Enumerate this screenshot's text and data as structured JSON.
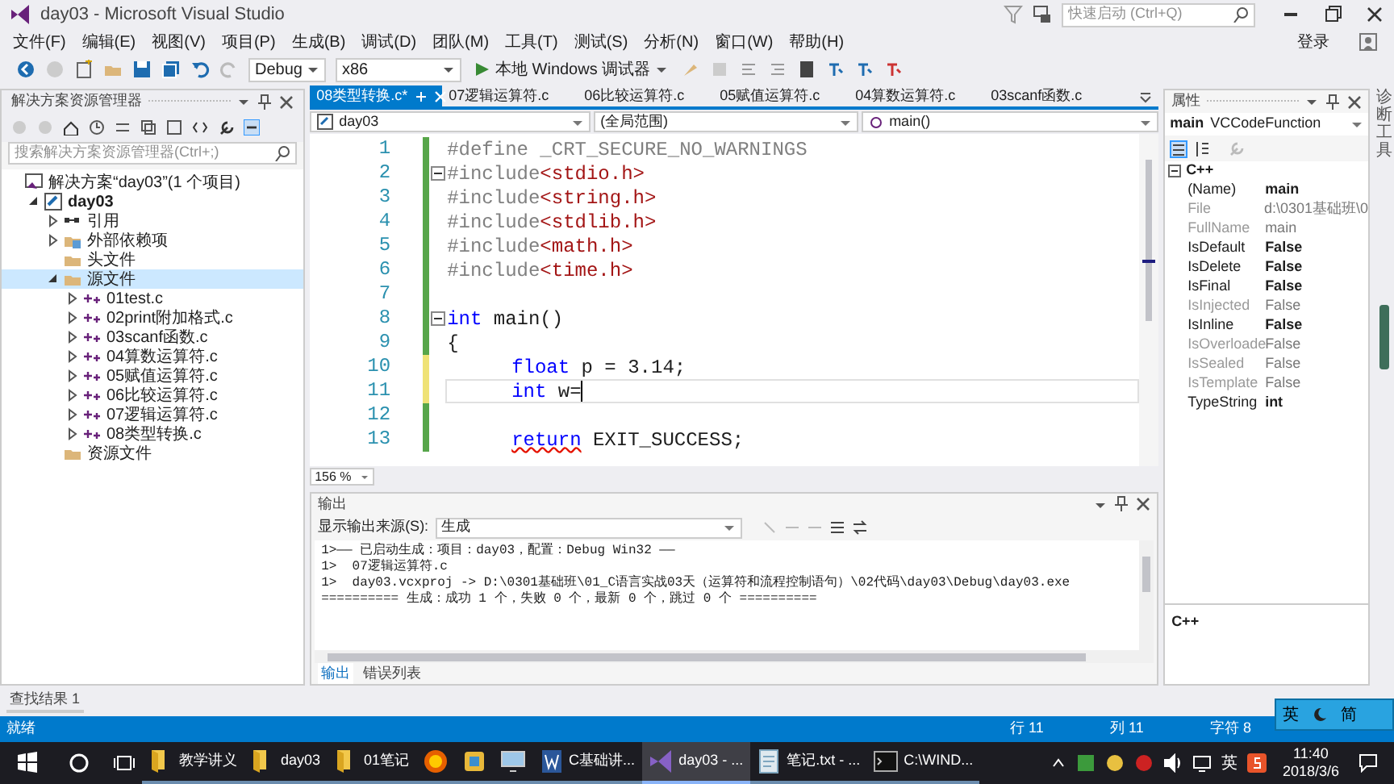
{
  "window": {
    "title": "day03 - Microsoft Visual Studio"
  },
  "quick_launch": {
    "placeholder": "快速启动 (Ctrl+Q)"
  },
  "sign_in": "登录",
  "menu": [
    "文件(F)",
    "编辑(E)",
    "视图(V)",
    "项目(P)",
    "生成(B)",
    "调试(D)",
    "团队(M)",
    "工具(T)",
    "测试(S)",
    "分析(N)",
    "窗口(W)",
    "帮助(H)"
  ],
  "toolbar": {
    "configuration": "Debug",
    "platform": "x86",
    "run": "本地 Windows 调试器"
  },
  "solution_explorer": {
    "title": "解决方案资源管理器",
    "search": {
      "placeholder": "搜索解决方案资源管理器(Ctrl+;)"
    },
    "tree": [
      {
        "label": "解决方案“day03”(1 个项目)",
        "kind": "solution",
        "selected": false,
        "children": [
          {
            "label": "day03",
            "kind": "project",
            "expanded": true,
            "selected": false,
            "children": [
              {
                "label": "引用",
                "kind": "references",
                "expanded": false,
                "selected": false
              },
              {
                "label": "外部依赖项",
                "kind": "dependencies",
                "expanded": false,
                "selected": false
              },
              {
                "label": "头文件",
                "kind": "folder",
                "selected": false
              },
              {
                "label": "源文件",
                "kind": "folder",
                "expanded": true,
                "selected": true,
                "children": [
                  {
                    "label": "01test.c",
                    "kind": "file",
                    "expanded": false,
                    "selected": false
                  },
                  {
                    "label": "02print附加格式.c",
                    "kind": "file",
                    "expanded": false,
                    "selected": false
                  },
                  {
                    "label": "03scanf函数.c",
                    "kind": "file",
                    "expanded": false,
                    "selected": false
                  },
                  {
                    "label": "04算数运算符.c",
                    "kind": "file",
                    "expanded": false,
                    "selected": false
                  },
                  {
                    "label": "05赋值运算符.c",
                    "kind": "file",
                    "expanded": false,
                    "selected": false
                  },
                  {
                    "label": "06比较运算符.c",
                    "kind": "file",
                    "expanded": false,
                    "selected": false
                  },
                  {
                    "label": "07逻辑运算符.c",
                    "kind": "file",
                    "expanded": false,
                    "selected": false
                  },
                  {
                    "label": "08类型转换.c",
                    "kind": "file",
                    "expanded": false,
                    "selected": false
                  }
                ]
              },
              {
                "label": "资源文件",
                "kind": "folder",
                "selected": false
              }
            ]
          }
        ]
      }
    ]
  },
  "editor": {
    "tabs": [
      {
        "label": "08类型转换.c*",
        "selected": true
      },
      {
        "label": "07逻辑运算符.c",
        "selected": false
      },
      {
        "label": "06比较运算符.c",
        "selected": false
      },
      {
        "label": "05赋值运算符.c",
        "selected": false
      },
      {
        "label": "04算数运算符.c",
        "selected": false
      },
      {
        "label": "03scanf函数.c",
        "selected": false
      }
    ],
    "nav": {
      "project": "day03",
      "scope": "(全局范围)",
      "member": "main()"
    },
    "lines": [
      {
        "number": "1",
        "modified": false,
        "fold": false,
        "current": false,
        "indented": false,
        "segments": [
          {
            "text": "#define _CRT_SECURE_NO_WARNINGS",
            "kind": "directive"
          }
        ]
      },
      {
        "number": "2",
        "modified": false,
        "fold": true,
        "current": false,
        "indented": false,
        "segments": [
          {
            "text": "#include",
            "kind": "directive"
          },
          {
            "text": "<stdio.h>",
            "kind": "header"
          }
        ]
      },
      {
        "number": "3",
        "modified": false,
        "fold": false,
        "current": false,
        "indented": false,
        "segments": [
          {
            "text": "#include",
            "kind": "directive"
          },
          {
            "text": "<string.h>",
            "kind": "header"
          }
        ]
      },
      {
        "number": "4",
        "modified": false,
        "fold": false,
        "current": false,
        "indented": false,
        "segments": [
          {
            "text": "#include",
            "kind": "directive"
          },
          {
            "text": "<stdlib.h>",
            "kind": "header"
          }
        ]
      },
      {
        "number": "5",
        "modified": false,
        "fold": false,
        "current": false,
        "indented": false,
        "segments": [
          {
            "text": "#include",
            "kind": "directive"
          },
          {
            "text": "<math.h>",
            "kind": "header"
          }
        ]
      },
      {
        "number": "6",
        "modified": false,
        "fold": false,
        "current": false,
        "indented": false,
        "segments": [
          {
            "text": "#include",
            "kind": "directive"
          },
          {
            "text": "<time.h>",
            "kind": "header"
          }
        ]
      },
      {
        "number": "7",
        "modified": false,
        "fold": false,
        "current": false,
        "indented": false
      },
      {
        "number": "8",
        "modified": false,
        "fold": true,
        "current": false,
        "indented": false,
        "segments": [
          {
            "text": "int",
            "kind": "keyword"
          },
          {
            "text": " main()",
            "kind": "plain"
          }
        ]
      },
      {
        "number": "9",
        "modified": false,
        "fold": false,
        "current": false,
        "indented": false,
        "segments": [
          {
            "text": "{",
            "kind": "plain"
          }
        ]
      },
      {
        "number": "10",
        "modified": true,
        "fold": false,
        "current": false,
        "indented": true,
        "segments": [
          {
            "text": "float",
            "kind": "keyword"
          },
          {
            "text": " p = 3.14;",
            "kind": "plain"
          }
        ]
      },
      {
        "number": "11",
        "modified": true,
        "fold": false,
        "current": true,
        "indented": true,
        "segments": [
          {
            "text": "int",
            "kind": "keyword"
          },
          {
            "text": " w=",
            "kind": "plain"
          }
        ]
      },
      {
        "number": "12",
        "modified": false,
        "fold": false,
        "current": false,
        "indented": false
      },
      {
        "number": "13",
        "modified": false,
        "fold": false,
        "current": false,
        "indented": true,
        "segments": [
          {
            "text": "return",
            "kind": "error"
          },
          {
            "text": " EXIT_SUCCESS;",
            "kind": "plain"
          }
        ]
      }
    ],
    "zoom": "156 %"
  },
  "output": {
    "title": "输出",
    "source_label": "显示输出来源(S):",
    "source": "生成",
    "lines": [
      "1>—— 已启动生成：项目：day03，配置：Debug Win32 ——",
      "1>  07逻辑运算符.c",
      "1>  day03.vcxproj -> D:\\0301基础班\\01_C语言实战03天（运算符和流程控制语句）\\02代码\\day03\\Debug\\day03.exe",
      "========== 生成：成功 1 个，失败 0 个，最新 0 个，跳过 0 个 =========="
    ],
    "tabs": [
      {
        "label": "输出",
        "selected": true
      },
      {
        "label": "错误列表",
        "selected": false
      }
    ]
  },
  "properties": {
    "title": "属性",
    "object": "main",
    "object_type": "VCCodeFunction",
    "category": "C++",
    "rows": [
      {
        "name": "(Name)",
        "value": "main",
        "readonly": false
      },
      {
        "name": "File",
        "value": "d:\\0301基础班\\0",
        "readonly": true
      },
      {
        "name": "FullName",
        "value": "main",
        "readonly": true
      },
      {
        "name": "IsDefault",
        "value": "False",
        "readonly": false
      },
      {
        "name": "IsDelete",
        "value": "False",
        "readonly": false
      },
      {
        "name": "IsFinal",
        "value": "False",
        "readonly": false
      },
      {
        "name": "IsInjected",
        "value": "False",
        "readonly": true
      },
      {
        "name": "IsInline",
        "value": "False",
        "readonly": false
      },
      {
        "name": "IsOverloade",
        "value": "False",
        "readonly": true
      },
      {
        "name": "IsSealed",
        "value": "False",
        "readonly": true
      },
      {
        "name": "IsTemplate",
        "value": "False",
        "readonly": true
      },
      {
        "name": "TypeString",
        "value": "int",
        "readonly": false
      }
    ],
    "description": "C++"
  },
  "side_tab": "诊断工具",
  "bottom_tab": "查找结果 1",
  "status_bar": {
    "state": "就绪",
    "line": "行 11",
    "column": "列 11",
    "char": "字符 8"
  },
  "ime": [
    "英",
    "简"
  ],
  "taskbar": {
    "items": [
      {
        "kind": "folder",
        "label": "教学讲义",
        "active": false
      },
      {
        "kind": "folder",
        "label": "day03",
        "active": false
      },
      {
        "kind": "folder",
        "label": "01笔记",
        "active": false
      },
      {
        "kind": "browser",
        "active": false
      },
      {
        "kind": "app",
        "active": false
      },
      {
        "kind": "monitor",
        "active": false
      },
      {
        "kind": "word",
        "label": "C基础讲...",
        "active": false
      },
      {
        "kind": "vs",
        "label": "day03 - ...",
        "active": true
      },
      {
        "kind": "notepad",
        "label": "笔记.txt - ...",
        "active": false
      },
      {
        "kind": "console",
        "label": "C:\\WIND...",
        "active": false
      }
    ],
    "tray_lang": "英",
    "time": "11:40",
    "date": "2018/3/6"
  }
}
